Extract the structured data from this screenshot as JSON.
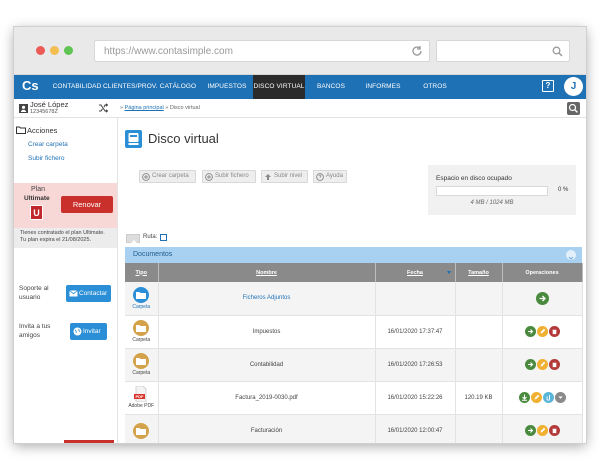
{
  "browser": {
    "url": "https://www.contasimple.com"
  },
  "nav": {
    "logo": "Cs",
    "items": [
      "CONTABILIDAD",
      "CLIENTES/PROV.",
      "CATÁLOGO",
      "IMPUESTOS",
      "DISCO VIRTUAL",
      "BANCOS",
      "INFORMES",
      "OTROS"
    ],
    "active": "DISCO VIRTUAL",
    "help": "?",
    "avatar_letter": "J"
  },
  "user": {
    "name": "José López",
    "id": "12345678Z"
  },
  "breadcrumb": {
    "sep": "»",
    "home": "Página principal",
    "current": "Disco virtual"
  },
  "sidebar": {
    "actions_title": "Acciones",
    "links": [
      "Crear carpeta",
      "Subir fichero"
    ],
    "plan": {
      "label": "Plan",
      "name": "Ultimate",
      "badge": "U",
      "renew_label": "Renovar",
      "info_line1": "Tienes contratado el plan Ultimate.",
      "info_line2": "Tu plan expira el 21/08/2025."
    },
    "support": {
      "text_line1": "Soporte al",
      "text_line2": "usuario",
      "button": "Contactar"
    },
    "invite": {
      "text_line1": "Invita a tus",
      "text_line2": "amigos",
      "button": "Invitar"
    }
  },
  "main": {
    "title": "Disco virtual",
    "toolbar": [
      "Crear carpeta",
      "Subir fichero",
      "Subir nivel",
      "Ayuda"
    ],
    "disk": {
      "title": "Espacio en disco ocupado",
      "percent": "0 %",
      "percent_value": 0,
      "size": "4 MB / 1024 MB"
    },
    "ruta_label": "Ruta:",
    "docs_title": "Documentos",
    "columns": [
      "Tipo",
      "Nombre",
      "Fecha",
      "Tamaño",
      "Operaciones"
    ],
    "rows": [
      {
        "type": "Carpeta",
        "name": "Ficheros Adjuntos",
        "date": "",
        "size": "",
        "icon": "folder-blue-icon",
        "ops": [
          "go"
        ]
      },
      {
        "type": "Carpeta",
        "name": "Impuestos",
        "date": "16/01/2020 17:37:47",
        "size": "",
        "icon": "folder-icon",
        "ops": [
          "go",
          "edit",
          "delete"
        ]
      },
      {
        "type": "Carpeta",
        "name": "Contabilidad",
        "date": "16/01/2020 17:26:53",
        "size": "",
        "icon": "folder-icon",
        "ops": [
          "go",
          "edit",
          "delete"
        ]
      },
      {
        "type": "Adobe PDF",
        "name": "Factura_2019-0030.pdf",
        "date": "16/01/2020 15:22:26",
        "size": "120.19 KB",
        "icon": "pdf-icon",
        "ops": [
          "download",
          "edit",
          "link",
          "more"
        ]
      },
      {
        "type": "Carpeta",
        "name": "Facturación",
        "date": "16/01/2020 12:00:47",
        "size": "",
        "icon": "folder-icon",
        "ops": [
          "go",
          "edit",
          "delete"
        ]
      }
    ]
  },
  "colors": {
    "nav_blue": "#1f71b5",
    "nav_active": "#2b2b2b",
    "renew_red": "#c9302c",
    "docs_header": "#a8d0f0",
    "table_header": "#8a8a8a",
    "op_green": "#4a8a3e",
    "op_yellow": "#f0b030",
    "op_red": "#b33a3a"
  }
}
